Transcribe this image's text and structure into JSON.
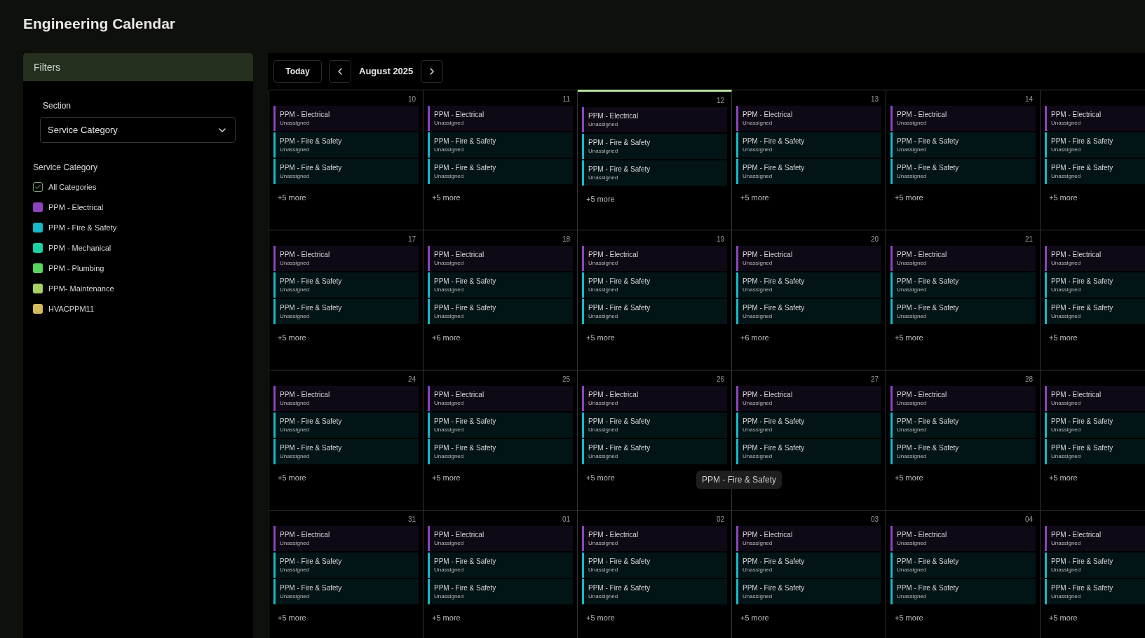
{
  "page_title": "Engineering Calendar",
  "filters": {
    "title": "Filters",
    "section_label": "Section",
    "section_value": "Service Category",
    "category_heading": "Service Category",
    "categories": [
      {
        "kind": "checkbox",
        "label": "All Categories",
        "checked": true
      },
      {
        "kind": "swatch",
        "label": "PPM - Electrical",
        "color": "#8b45c0"
      },
      {
        "kind": "swatch",
        "label": "PPM - Fire & Safety",
        "color": "#17b9c9"
      },
      {
        "kind": "swatch",
        "label": "PPM - Mechanical",
        "color": "#1ad3a5"
      },
      {
        "kind": "swatch",
        "label": "PPM - Plumbing",
        "color": "#57d660"
      },
      {
        "kind": "swatch",
        "label": "PPM- Maintenance",
        "color": "#a8d162"
      },
      {
        "kind": "swatch",
        "label": "HVACPPM11",
        "color": "#d4bb5c"
      }
    ]
  },
  "toolbar": {
    "today": "Today",
    "month": "August 2025"
  },
  "weeks": [
    {
      "days": [
        {
          "date": "10",
          "today": false,
          "more": "+5 more",
          "events": [
            {
              "title": "PPM - Electrical",
              "assignee": "Unassigned",
              "color": "#8b45c0"
            },
            {
              "title": "PPM - Fire & Safety",
              "assignee": "Unassigned",
              "color": "#17b9c9"
            },
            {
              "title": "PPM - Fire & Safety",
              "assignee": "Unassigned",
              "color": "#17b9c9"
            }
          ]
        },
        {
          "date": "11",
          "today": false,
          "more": "+5 more",
          "events": [
            {
              "title": "PPM - Electrical",
              "assignee": "Unassigned",
              "color": "#8b45c0"
            },
            {
              "title": "PPM - Fire & Safety",
              "assignee": "Unassigned",
              "color": "#17b9c9"
            },
            {
              "title": "PPM - Fire & Safety",
              "assignee": "Unassigned",
              "color": "#17b9c9"
            }
          ]
        },
        {
          "date": "12",
          "today": true,
          "more": "+5 more",
          "events": [
            {
              "title": "PPM - Electrical",
              "assignee": "Unassigned",
              "color": "#8b45c0"
            },
            {
              "title": "PPM - Fire & Safety",
              "assignee": "Unassigned",
              "color": "#17b9c9"
            },
            {
              "title": "PPM - Fire & Safety",
              "assignee": "Unassigned",
              "color": "#17b9c9"
            }
          ]
        },
        {
          "date": "13",
          "today": false,
          "more": "+5 more",
          "events": [
            {
              "title": "PPM - Electrical",
              "assignee": "Unassigned",
              "color": "#8b45c0"
            },
            {
              "title": "PPM - Fire & Safety",
              "assignee": "Unassigned",
              "color": "#17b9c9"
            },
            {
              "title": "PPM - Fire & Safety",
              "assignee": "Unassigned",
              "color": "#17b9c9"
            }
          ]
        },
        {
          "date": "14",
          "today": false,
          "more": "+5 more",
          "events": [
            {
              "title": "PPM - Electrical",
              "assignee": "Unassigned",
              "color": "#8b45c0"
            },
            {
              "title": "PPM - Fire & Safety",
              "assignee": "Unassigned",
              "color": "#17b9c9"
            },
            {
              "title": "PPM - Fire & Safety",
              "assignee": "Unassigned",
              "color": "#17b9c9"
            }
          ]
        },
        {
          "today": false,
          "more": "+5 more",
          "events": [
            {
              "title": "PPM - Electrical",
              "assignee": "Unassigned",
              "color": "#8b45c0"
            },
            {
              "title": "PPM - Fire & Safety",
              "assignee": "Unassigned",
              "color": "#17b9c9"
            },
            {
              "title": "PPM - Fire & Safety",
              "assignee": "Unassigned",
              "color": "#17b9c9"
            }
          ]
        }
      ]
    },
    {
      "days": [
        {
          "date": "17",
          "today": false,
          "more": "+5 more",
          "events": [
            {
              "title": "PPM - Electrical",
              "assignee": "Unassigned",
              "color": "#8b45c0"
            },
            {
              "title": "PPM - Fire & Safety",
              "assignee": "Unassigned",
              "color": "#17b9c9"
            },
            {
              "title": "PPM - Fire & Safety",
              "assignee": "Unassigned",
              "color": "#17b9c9"
            }
          ]
        },
        {
          "date": "18",
          "today": false,
          "more": "+6 more",
          "events": [
            {
              "title": "PPM - Electrical",
              "assignee": "Unassigned",
              "color": "#8b45c0"
            },
            {
              "title": "PPM - Fire & Safety",
              "assignee": "Unassigned",
              "color": "#17b9c9"
            },
            {
              "title": "PPM - Fire & Safety",
              "assignee": "Unassigned",
              "color": "#17b9c9"
            }
          ]
        },
        {
          "date": "19",
          "today": false,
          "more": "+5 more",
          "events": [
            {
              "title": "PPM - Electrical",
              "assignee": "Unassigned",
              "color": "#8b45c0"
            },
            {
              "title": "PPM - Fire & Safety",
              "assignee": "Unassigned",
              "color": "#17b9c9"
            },
            {
              "title": "PPM - Fire & Safety",
              "assignee": "Unassigned",
              "color": "#17b9c9"
            }
          ]
        },
        {
          "date": "20",
          "today": false,
          "more": "+6 more",
          "events": [
            {
              "title": "PPM - Electrical",
              "assignee": "Unassigned",
              "color": "#8b45c0"
            },
            {
              "title": "PPM - Fire & Safety",
              "assignee": "Unassigned",
              "color": "#17b9c9"
            },
            {
              "title": "PPM - Fire & Safety",
              "assignee": "Unassigned",
              "color": "#17b9c9"
            }
          ]
        },
        {
          "date": "21",
          "today": false,
          "more": "+5 more",
          "events": [
            {
              "title": "PPM - Electrical",
              "assignee": "Unassigned",
              "color": "#8b45c0"
            },
            {
              "title": "PPM - Fire & Safety",
              "assignee": "Unassigned",
              "color": "#17b9c9"
            },
            {
              "title": "PPM - Fire & Safety",
              "assignee": "Unassigned",
              "color": "#17b9c9"
            }
          ]
        },
        {
          "today": false,
          "more": "+5 more",
          "events": [
            {
              "title": "PPM - Electrical",
              "assignee": "Unassigned",
              "color": "#8b45c0"
            },
            {
              "title": "PPM - Fire & Safety",
              "assignee": "Unassigned",
              "color": "#17b9c9"
            },
            {
              "title": "PPM - Fire & Safety",
              "assignee": "Unassigned",
              "color": "#17b9c9"
            }
          ]
        }
      ]
    },
    {
      "days": [
        {
          "date": "24",
          "today": false,
          "more": "+5 more",
          "events": [
            {
              "title": "PPM - Electrical",
              "assignee": "Unassigned",
              "color": "#8b45c0"
            },
            {
              "title": "PPM - Fire & Safety",
              "assignee": "Unassigned",
              "color": "#17b9c9"
            },
            {
              "title": "PPM - Fire & Safety",
              "assignee": "Unassigned",
              "color": "#17b9c9"
            }
          ]
        },
        {
          "date": "25",
          "today": false,
          "more": "+5 more",
          "events": [
            {
              "title": "PPM - Electrical",
              "assignee": "Unassigned",
              "color": "#8b45c0"
            },
            {
              "title": "PPM - Fire & Safety",
              "assignee": "Unassigned",
              "color": "#17b9c9"
            },
            {
              "title": "PPM - Fire & Safety",
              "assignee": "Unassigned",
              "color": "#17b9c9"
            }
          ]
        },
        {
          "date": "26",
          "today": false,
          "more": "+5 more",
          "events": [
            {
              "title": "PPM - Electrical",
              "assignee": "Unassigned",
              "color": "#8b45c0"
            },
            {
              "title": "PPM - Fire & Safety",
              "assignee": "Unassigned",
              "color": "#17b9c9"
            },
            {
              "title": "PPM - Fire & Safety",
              "assignee": "Unassigned",
              "color": "#17b9c9"
            }
          ]
        },
        {
          "date": "27",
          "today": false,
          "events": [
            {
              "title": "PPM - Electrical",
              "assignee": "Unassigned",
              "color": "#8b45c0"
            },
            {
              "title": "PPM - Fire & Safety",
              "assignee": "Unassigned",
              "color": "#17b9c9"
            },
            {
              "title": "PPM - Fire & Safety",
              "assignee": "Unassigned",
              "color": "#17b9c9"
            }
          ]
        },
        {
          "date": "28",
          "today": false,
          "more": "+5 more",
          "events": [
            {
              "title": "PPM - Electrical",
              "assignee": "Unassigned",
              "color": "#8b45c0"
            },
            {
              "title": "PPM - Fire & Safety",
              "assignee": "Unassigned",
              "color": "#17b9c9"
            },
            {
              "title": "PPM - Fire & Safety",
              "assignee": "Unassigned",
              "color": "#17b9c9"
            }
          ]
        },
        {
          "today": false,
          "more": "+5 more",
          "events": [
            {
              "title": "PPM - Electrical",
              "assignee": "Unassigned",
              "color": "#8b45c0"
            },
            {
              "title": "PPM - Fire & Safety",
              "assignee": "Unassigned",
              "color": "#17b9c9"
            },
            {
              "title": "PPM - Fire & Safety",
              "assignee": "Unassigned",
              "color": "#17b9c9"
            }
          ]
        }
      ]
    },
    {
      "days": [
        {
          "date": "31",
          "today": false,
          "more": "+5 more",
          "events": [
            {
              "title": "PPM - Electrical",
              "assignee": "Unassigned",
              "color": "#8b45c0"
            },
            {
              "title": "PPM - Fire & Safety",
              "assignee": "Unassigned",
              "color": "#17b9c9"
            },
            {
              "title": "PPM - Fire & Safety",
              "assignee": "Unassigned",
              "color": "#17b9c9"
            }
          ]
        },
        {
          "date": "01",
          "today": false,
          "more": "+5 more",
          "events": [
            {
              "title": "PPM - Electrical",
              "assignee": "Unassigned",
              "color": "#8b45c0"
            },
            {
              "title": "PPM - Fire & Safety",
              "assignee": "Unassigned",
              "color": "#17b9c9"
            },
            {
              "title": "PPM - Fire & Safety",
              "assignee": "Unassigned",
              "color": "#17b9c9"
            }
          ]
        },
        {
          "date": "02",
          "today": false,
          "more": "+5 more",
          "events": [
            {
              "title": "PPM - Electrical",
              "assignee": "Unassigned",
              "color": "#8b45c0"
            },
            {
              "title": "PPM - Fire & Safety",
              "assignee": "Unassigned",
              "color": "#17b9c9"
            },
            {
              "title": "PPM - Fire & Safety",
              "assignee": "Unassigned",
              "color": "#17b9c9"
            }
          ]
        },
        {
          "date": "03",
          "today": false,
          "more": "+5 more",
          "events": [
            {
              "title": "PPM - Electrical",
              "assignee": "Unassigned",
              "color": "#8b45c0"
            },
            {
              "title": "PPM - Fire & Safety",
              "assignee": "Unassigned",
              "color": "#17b9c9"
            },
            {
              "title": "PPM - Fire & Safety",
              "assignee": "Unassigned",
              "color": "#17b9c9"
            }
          ]
        },
        {
          "date": "04",
          "today": false,
          "more": "+5 more",
          "events": [
            {
              "title": "PPM - Electrical",
              "assignee": "Unassigned",
              "color": "#8b45c0"
            },
            {
              "title": "PPM - Fire & Safety",
              "assignee": "Unassigned",
              "color": "#17b9c9"
            },
            {
              "title": "PPM - Fire & Safety",
              "assignee": "Unassigned",
              "color": "#17b9c9"
            }
          ]
        },
        {
          "today": false,
          "more": "+5 more",
          "events": [
            {
              "title": "PPM - Electrical",
              "assignee": "Unassigned",
              "color": "#8b45c0"
            },
            {
              "title": "PPM - Fire & Safety",
              "assignee": "Unassigned",
              "color": "#17b9c9"
            },
            {
              "title": "PPM - Fire & Safety",
              "assignee": "Unassigned",
              "color": "#17b9c9"
            }
          ]
        }
      ]
    }
  ],
  "tooltip": {
    "text": "PPM - Fire & Safety"
  }
}
